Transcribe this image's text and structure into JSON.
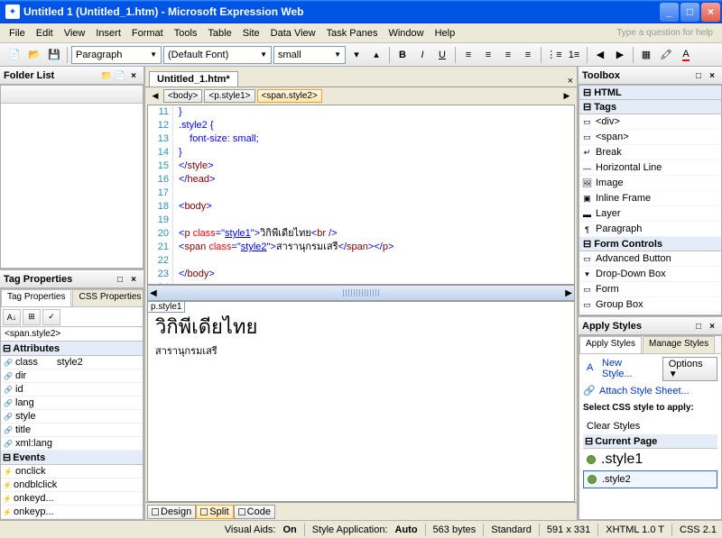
{
  "titlebar": {
    "title": "Untitled 1 (Untitled_1.htm) - Microsoft Expression Web"
  },
  "menu": {
    "file": "File",
    "edit": "Edit",
    "view": "View",
    "insert": "Insert",
    "format": "Format",
    "tools": "Tools",
    "table": "Table",
    "site": "Site",
    "dataview": "Data View",
    "taskpanes": "Task Panes",
    "window": "Window",
    "help": "Help",
    "helpbox": "Type a question for help"
  },
  "toolbar": {
    "style": "Paragraph",
    "font": "(Default Font)",
    "size": "small"
  },
  "panels": {
    "folderlist": "Folder List",
    "tagprops": "Tag Properties",
    "tagprops_tab": "Tag Properties",
    "cssprops_tab": "CSS Properties",
    "tagprops_sel": "<span.style2>",
    "attributes": "Attributes",
    "events": "Events",
    "toolbox": "Toolbox",
    "html": "HTML",
    "tags": "Tags",
    "formcontrols": "Form Controls",
    "applystyles": "Apply Styles",
    "applystyles_tab": "Apply Styles",
    "managestyles_tab": "Manage Styles",
    "newstyle": "New Style...",
    "options": "Options",
    "attachss": "Attach Style Sheet...",
    "selectcss": "Select CSS style to apply:",
    "clearstyles": "Clear Styles",
    "currentpage": "Current Page"
  },
  "attrs": {
    "class": "class",
    "class_v": "style2",
    "dir": "dir",
    "id": "id",
    "lang": "lang",
    "style": "style",
    "title": "title",
    "xmllang": "xml:lang"
  },
  "events": {
    "onclick": "onclick",
    "ondblclick": "ondblclick",
    "onkeyd": "onkeyd...",
    "onkeyp": "onkeyp..."
  },
  "tbitems": {
    "div": "<div>",
    "span": "<span>",
    "break": "Break",
    "hr": "Horizontal Line",
    "image": "Image",
    "iframe": "Inline Frame",
    "layer": "Layer",
    "paragraph": "Paragraph",
    "advbtn": "Advanced Button",
    "ddbox": "Drop-Down Box",
    "form": "Form",
    "groupbox": "Group Box"
  },
  "doc": {
    "tab": "Untitled_1.htm*",
    "bc_body": "<body>",
    "bc_p": "<p.style1>",
    "bc_span": "<span.style2>",
    "seltag": "p.style1"
  },
  "code": {
    "l11": "}",
    "l12": ".style2 {",
    "l13": "    font-size: small;",
    "l14": "}",
    "l15_a": "</",
    "l15_b": "style",
    "l15_c": ">",
    "l16_a": "</",
    "l16_b": "head",
    "l16_c": ">",
    "l18_a": "<",
    "l18_b": "body",
    "l18_c": ">",
    "l20_a": "<",
    "l20_b": "p ",
    "l20_c": "class",
    "l20_d": "=\"",
    "l20_e": "style1",
    "l20_f": "\">",
    "l20_g": "วิกิพีเดียไทย",
    "l20_h": "<",
    "l20_i": "br ",
    "l20_j": "/>",
    "l21_a": "<",
    "l21_b": "span ",
    "l21_c": "class",
    "l21_d": "=\"",
    "l21_e": "style2",
    "l21_f": "\">",
    "l21_g": "สารานุกรมเสรี",
    "l21_h": "</",
    "l21_i": "span",
    "l21_j": "></",
    "l21_k": "p",
    "l21_l": ">",
    "l23_a": "</",
    "l23_b": "body",
    "l23_c": ">"
  },
  "design": {
    "line1": "วิกิพีเดียไทย",
    "line2": "สารานุกรมเสรี"
  },
  "viewtabs": {
    "design": "Design",
    "split": "Split",
    "code": "Code"
  },
  "styles": {
    "s1": ".style1",
    "s2": ".style2"
  },
  "status": {
    "visaids": "Visual Aids:",
    "on": "On",
    "styleapp": "Style Application:",
    "auto": "Auto",
    "bytes": "563 bytes",
    "std": "Standard",
    "dim": "591 x 331",
    "xhtml": "XHTML 1.0 T",
    "css": "CSS 2.1"
  }
}
